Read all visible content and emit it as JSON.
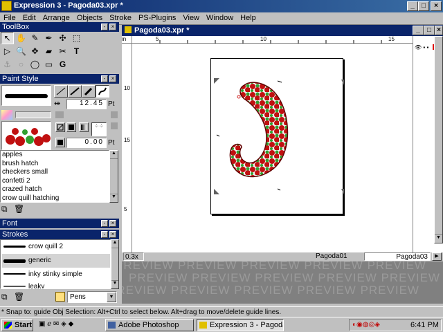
{
  "window": {
    "title": "Expression 3 - Pagoda03.xpr *"
  },
  "menu": [
    "File",
    "Edit",
    "Arrange",
    "Objects",
    "Stroke",
    "PS-Plugins",
    "View",
    "Window",
    "Help"
  ],
  "toolbox": {
    "title": "ToolBox"
  },
  "paint_style": {
    "title": "Paint Style",
    "width_value": "12.45",
    "width_unit": "Pt",
    "angle_value": "0.00",
    "angle_unit": "Pt",
    "items": [
      "apples",
      "brush hatch",
      "checkers small",
      "confetti 2",
      "crazed hatch",
      "crow quill hatching"
    ]
  },
  "font_panel": {
    "title": "Font"
  },
  "strokes_panel": {
    "title": "Strokes",
    "items": [
      "crow quill 2",
      "generic",
      "inky stinky simple",
      "leaky"
    ],
    "category": "Pens"
  },
  "document": {
    "title": "Pagoda03.xpr *",
    "ruler_h_ticks": [
      "5",
      "10",
      "15"
    ],
    "ruler_v_ticks": [
      "10",
      "15",
      "5"
    ],
    "zoom": "0.3x",
    "layer_left": "Pagoda01",
    "layer_right": "Pagoda03",
    "preview_text": "PREVIEW"
  },
  "status_text": "* Snap to: guide    Obj Selection: Alt+Ctrl to select below. Alt+drag to move/delete guide lines.",
  "taskbar": {
    "start": "Start",
    "tasks": [
      "Adobe Photoshop",
      "Expression 3 - Pagoda..."
    ],
    "clock": "6:41 PM"
  },
  "colors": {
    "titlebar": "#0a246a",
    "apple_red": "#c01010",
    "leaf_green": "#30a030"
  }
}
